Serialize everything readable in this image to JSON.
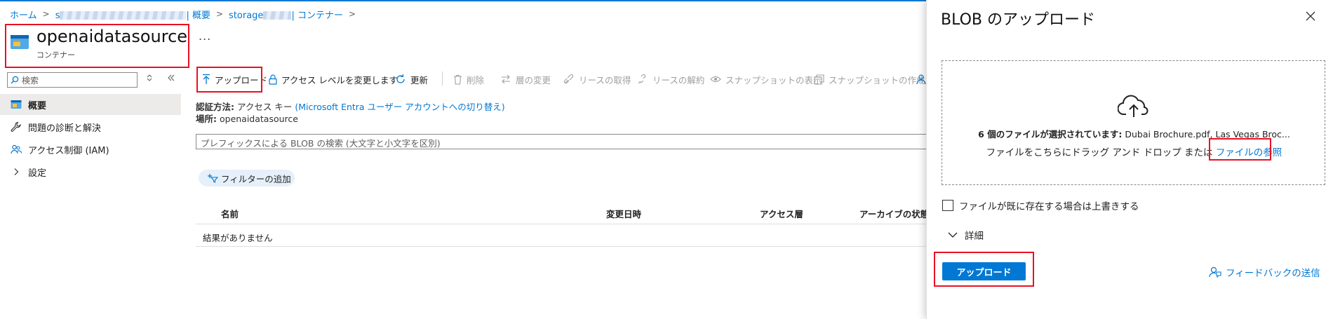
{
  "breadcrumb": {
    "home": "ホーム",
    "item2_suffix": "| 概要",
    "item3_prefix": "storage",
    "item3_suffix": "| コンテナー"
  },
  "header": {
    "title": "openaidatasource",
    "subtitle": "コンテナー",
    "more": "..."
  },
  "sidebar": {
    "search_placeholder": "検索",
    "items": [
      {
        "label": "概要",
        "icon": "container-icon",
        "active": true
      },
      {
        "label": "問題の診断と解決",
        "icon": "wrench-icon"
      },
      {
        "label": "アクセス制御 (IAM)",
        "icon": "people-icon"
      },
      {
        "label": "設定",
        "icon": "chevron-right-icon"
      }
    ]
  },
  "toolbar": {
    "upload": "アップロード",
    "change_access": "アクセス レベルを変更します",
    "refresh": "更新",
    "delete": "削除",
    "change_tier": "層の変更",
    "acquire_lease": "リースの取得",
    "break_lease": "リースの解約",
    "view_snapshots": "スナップショットの表示",
    "create_snapshot": "スナップショットの作成"
  },
  "main": {
    "auth_label": "認証方法:",
    "auth_value": "アクセス キー",
    "auth_link": "(Microsoft Entra ユーザー アカウントへの切り替え)",
    "location_label": "場所:",
    "location_value": "openaidatasource",
    "prefix_search_placeholder": "プレフィックスによる BLOB の検索 (大文字と小文字を区別)",
    "add_filter": "フィルターの追加",
    "columns": [
      "名前",
      "変更日時",
      "アクセス層",
      "アーカイブの状態"
    ],
    "no_results": "結果がありません"
  },
  "panel": {
    "title": "BLOB のアップロード",
    "selected_prefix": "6 個のファイルが選択されています:",
    "selected_files": "Dubai Brochure.pdf, Las Vegas Broc...",
    "drag_text": "ファイルをこちらにドラッグ アンド ドロップ または",
    "browse_link": "ファイルの参照",
    "overwrite_label": "ファイルが既に存在する場合は上書きする",
    "overwrite_checked": false,
    "details_label": "詳細",
    "upload_button": "アップロード",
    "feedback_link": "フィードバックの送信"
  },
  "colors": {
    "accent": "#0078d4",
    "highlight": "#e81123"
  }
}
